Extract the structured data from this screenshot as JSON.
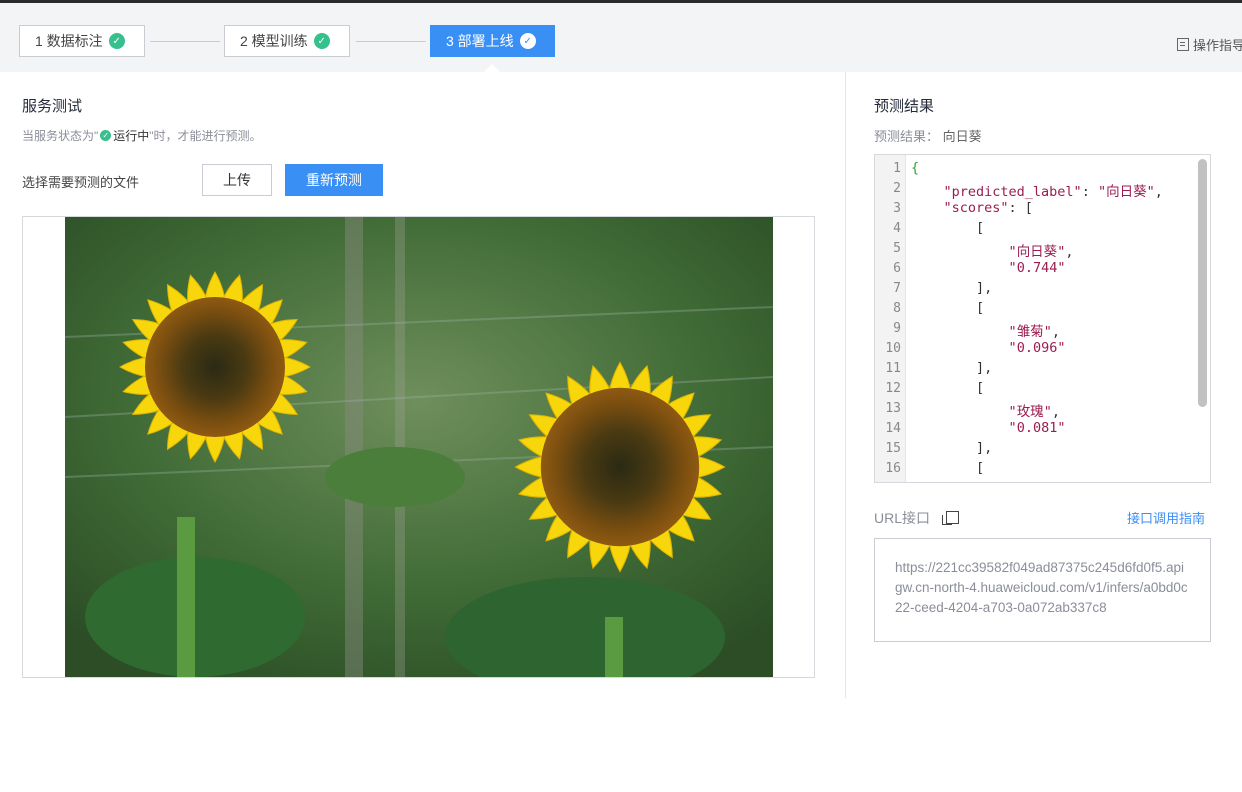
{
  "steps": [
    {
      "label": "1 数据标注",
      "check": "✓"
    },
    {
      "label": "2 模型训练",
      "check": "✓"
    },
    {
      "label": "3 部署上线",
      "check": "✓"
    }
  ],
  "guide_label": "操作指导",
  "service": {
    "title": "服务测试",
    "note_prefix": "当服务状态为\"",
    "note_status": "运行中",
    "note_suffix": "\"时，才能进行预测。",
    "select_label": "选择需要预测的文件",
    "upload_label": "上传",
    "repredict_label": "重新预测"
  },
  "result": {
    "title": "预测结果",
    "summary_label": "预测结果：",
    "summary_value": "向日葵",
    "line_numbers": [
      "1",
      "2",
      "3",
      "4",
      "5",
      "6",
      "7",
      "8",
      "9",
      "10",
      "11",
      "12",
      "13",
      "14",
      "15",
      "16"
    ],
    "json_predicted_label": "向日葵",
    "scores": [
      {
        "name": "向日葵",
        "score": "0.744"
      },
      {
        "name": "雏菊",
        "score": "0.096"
      },
      {
        "name": "玫瑰",
        "score": "0.081"
      }
    ]
  },
  "url": {
    "label": "URL接口",
    "guide_link": "接口调用指南",
    "value": "https://221cc39582f049ad87375c245d6fd0f5.apigw.cn-north-4.huaweicloud.com/v1/infers/a0bd0c22-ceed-4204-a703-0a072ab337c8"
  },
  "colors": {
    "primary": "#3a8ff5",
    "success": "#36c08d"
  }
}
